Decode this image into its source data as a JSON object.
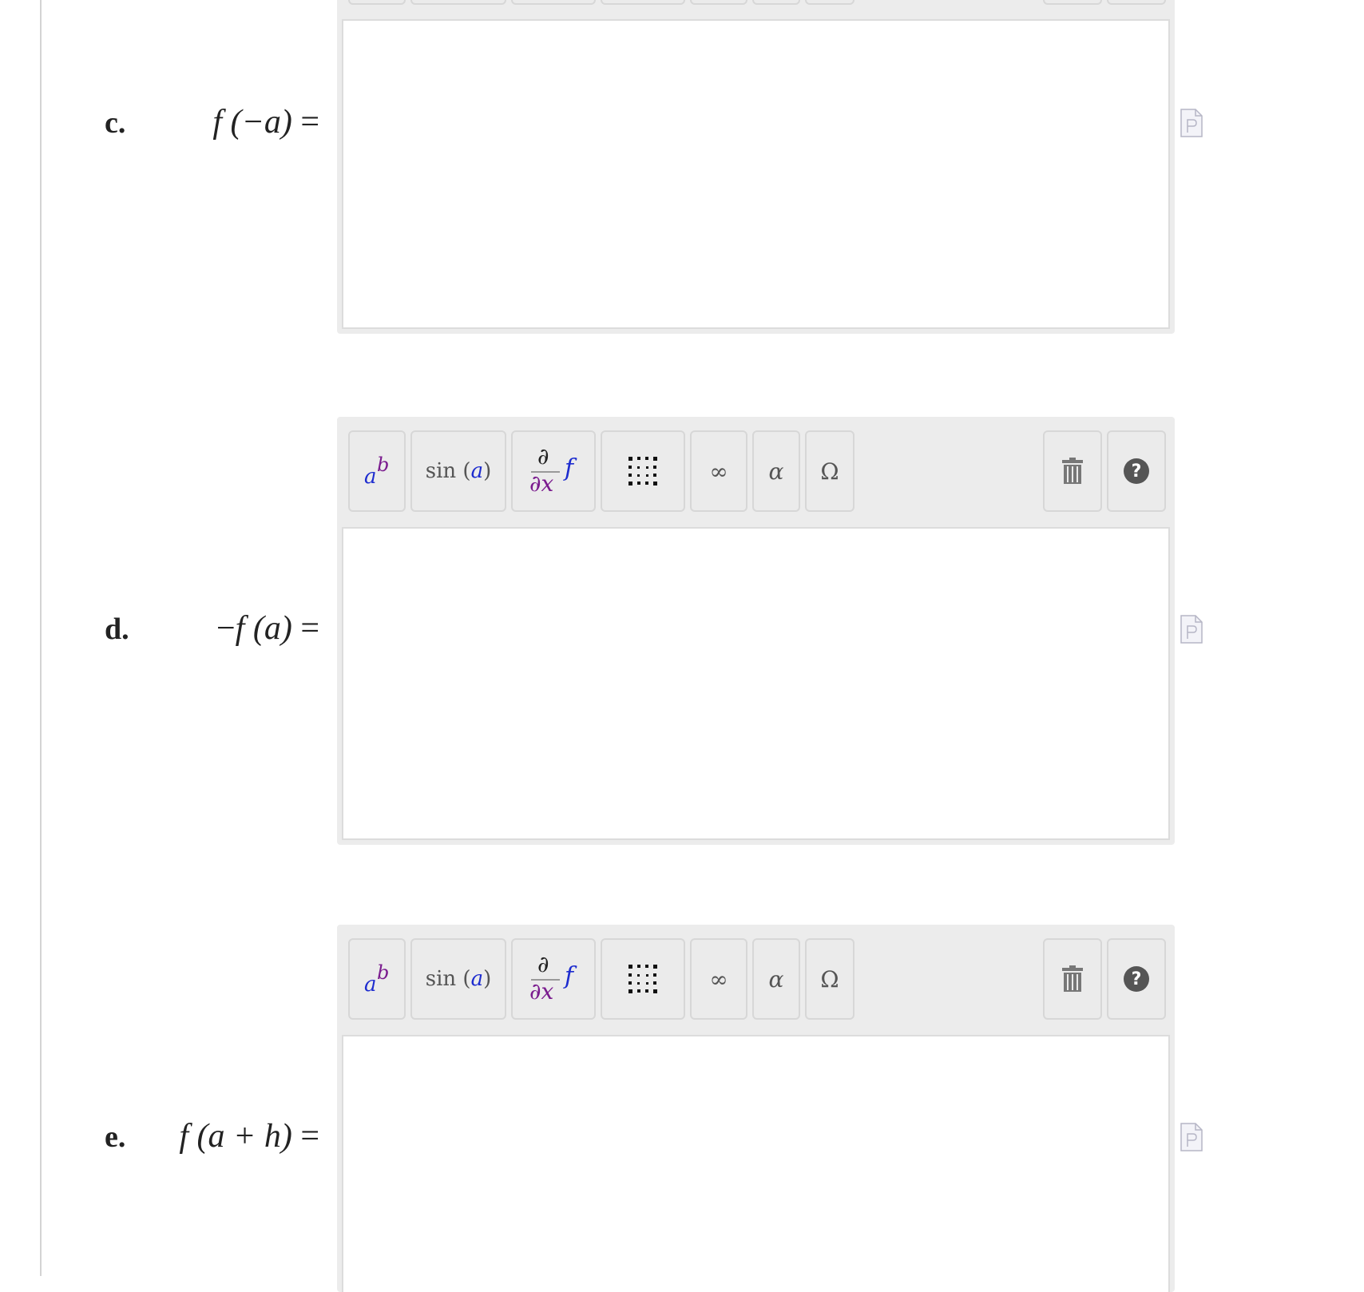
{
  "toolbar": {
    "power_base": "a",
    "power_exp": "b",
    "sin_fn": "sin",
    "sin_arg": "a",
    "deriv_num": "∂",
    "deriv_den": "∂x",
    "deriv_fn": "f",
    "infinity": "∞",
    "alpha": "α",
    "omega": "Ω",
    "help": "?"
  },
  "parts": [
    {
      "label": "c.",
      "lhs_func": "f",
      "lhs_arg": "(−a)",
      "equals": "="
    },
    {
      "label": "d.",
      "lhs_prefix": "−",
      "lhs_func": "f",
      "lhs_arg": "(a)",
      "equals": "="
    },
    {
      "label": "e.",
      "lhs_func": "f",
      "lhs_arg": "(a + h)",
      "equals": "="
    }
  ],
  "colors": {
    "var_blue": "#1d2ccf",
    "var_purple": "#7a1b8e",
    "panel_bg": "#ececec",
    "button_border": "#d7d7d7"
  },
  "icons": [
    "power-icon",
    "sin-icon",
    "derivative-icon",
    "matrix-icon",
    "infinity-icon",
    "alpha-icon",
    "omega-icon",
    "trash-icon",
    "help-icon",
    "document-icon"
  ]
}
